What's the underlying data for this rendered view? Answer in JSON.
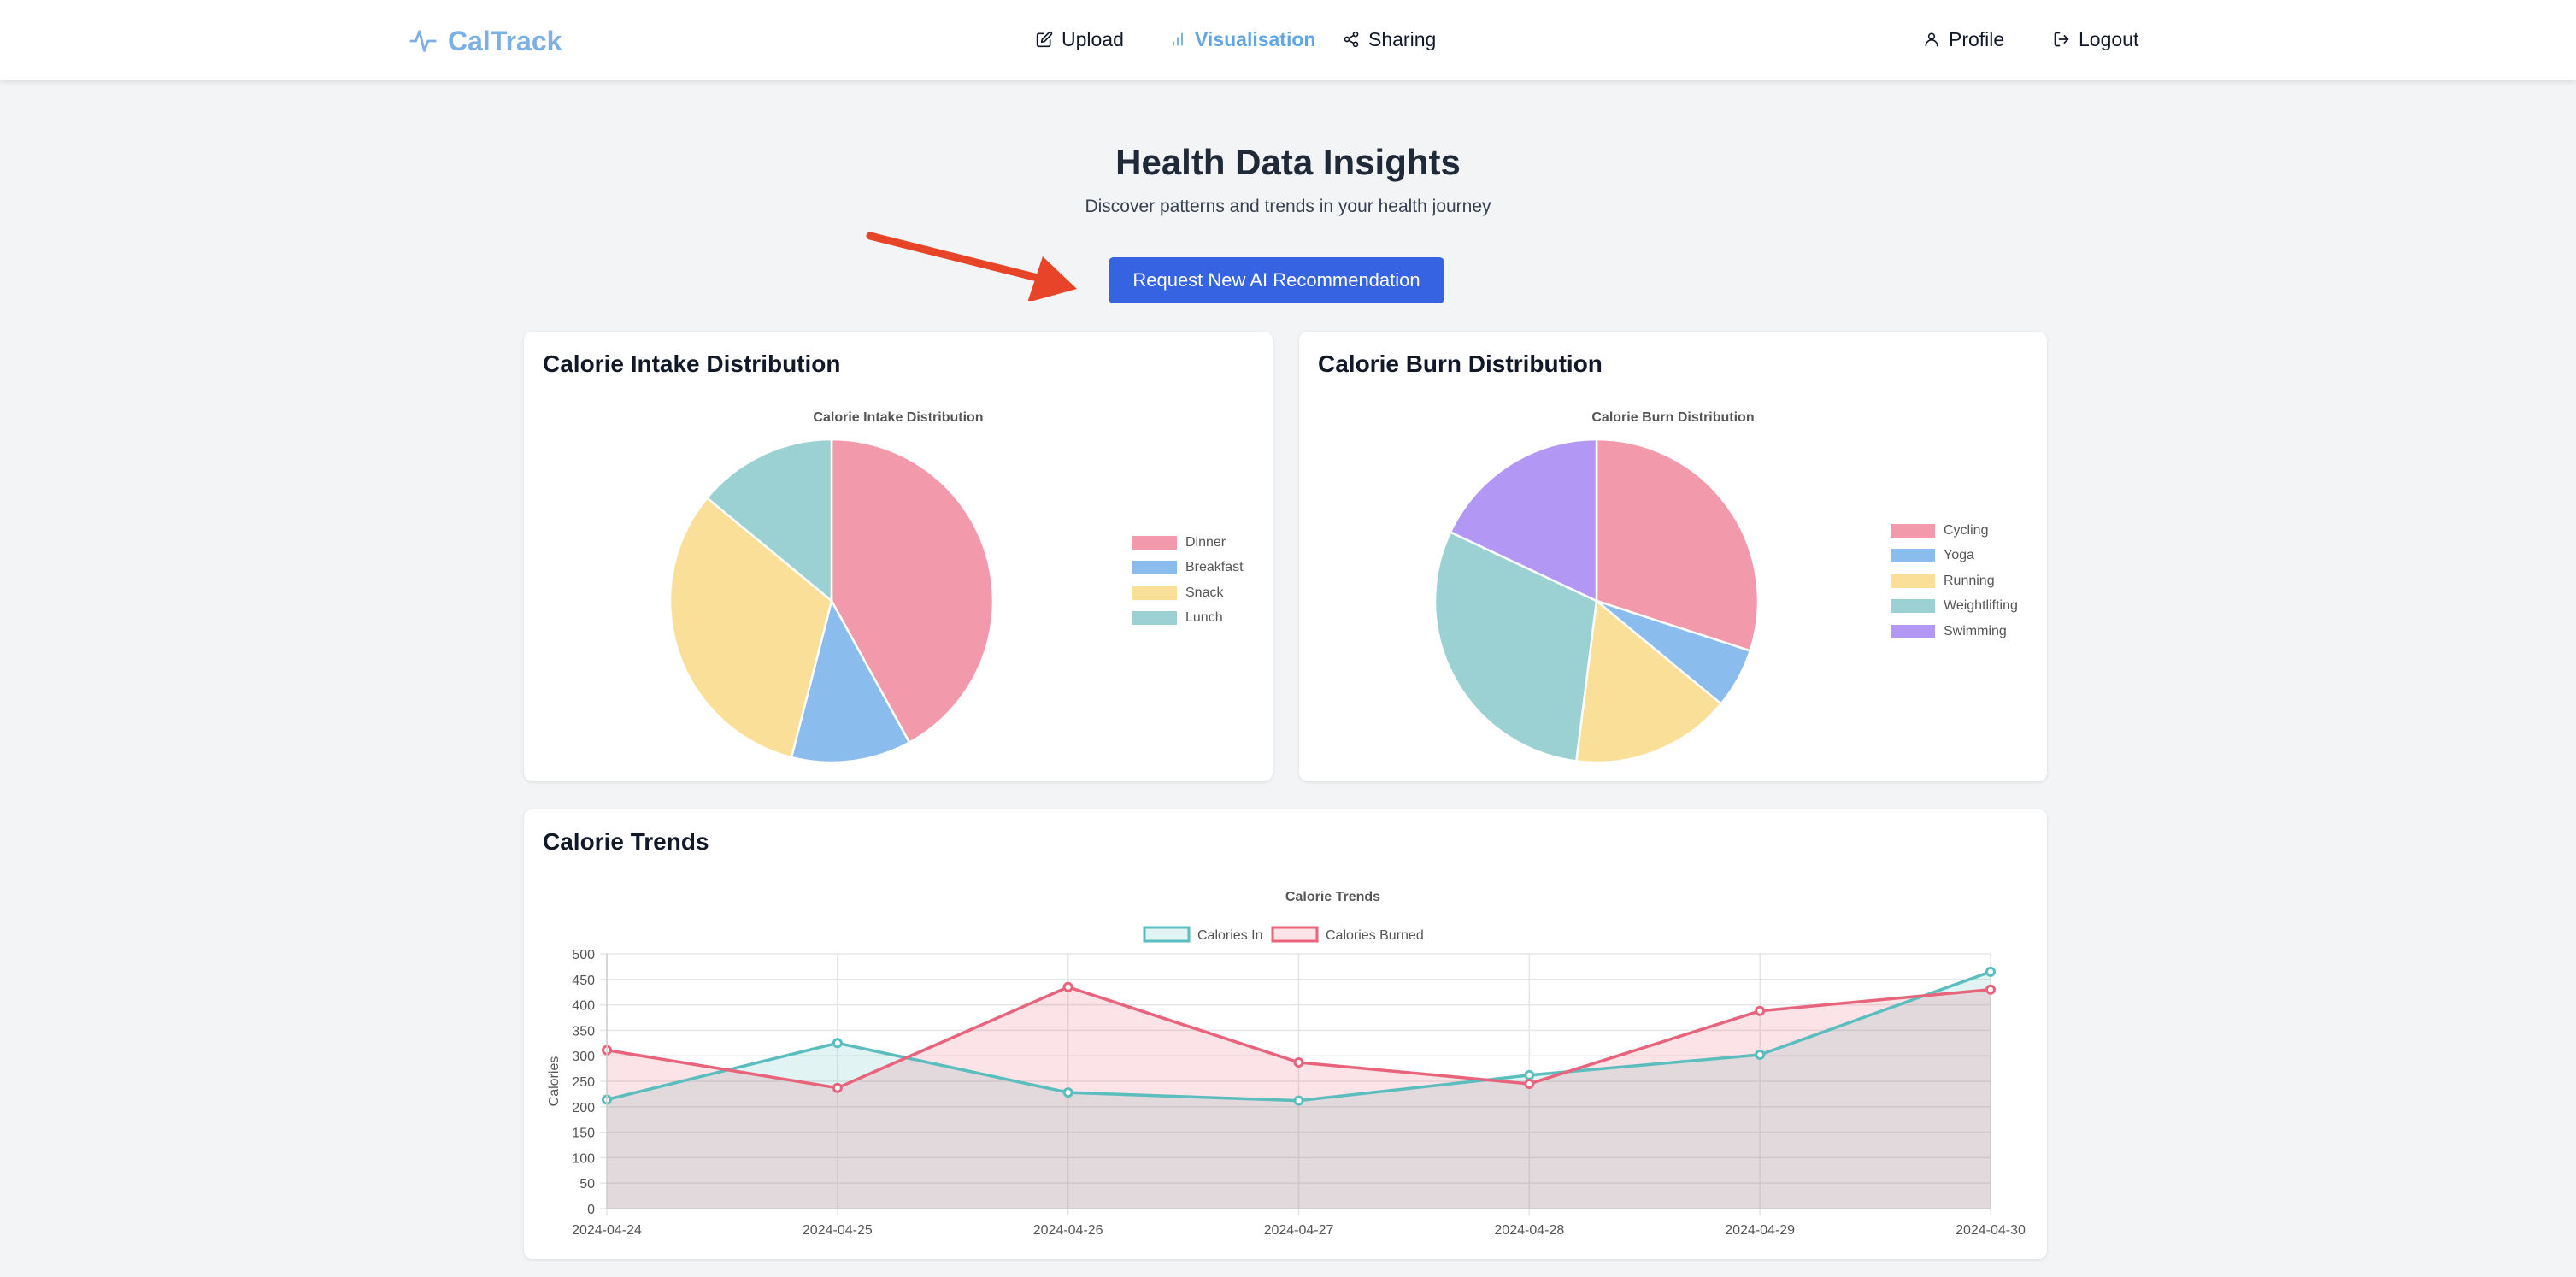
{
  "brand": {
    "name": "CalTrack",
    "color": "#7cb0e4"
  },
  "nav": {
    "upload": "Upload",
    "visualisation": "Visualisation",
    "sharing": "Sharing",
    "profile": "Profile",
    "logout": "Logout"
  },
  "hero": {
    "title": "Health Data Insights",
    "subtitle": "Discover patterns and trends in your health journey",
    "cta": "Request New AI Recommendation"
  },
  "cards": {
    "intake_title": "Calorie Intake Distribution",
    "burn_title": "Calorie Burn Distribution",
    "trends_title": "Calorie Trends"
  },
  "chart_data": [
    {
      "type": "pie",
      "title": "Calorie Intake Distribution",
      "labels": [
        "Dinner",
        "Breakfast",
        "Snack",
        "Lunch"
      ],
      "values": [
        42,
        12,
        32,
        14
      ],
      "colors": [
        "#f29aab",
        "#8abded",
        "#f9df98",
        "#9bd1d2"
      ],
      "legend": "right"
    },
    {
      "type": "pie",
      "title": "Calorie Burn Distribution",
      "labels": [
        "Cycling",
        "Yoga",
        "Running",
        "Weightlifting",
        "Swimming"
      ],
      "values": [
        30,
        6,
        16,
        30,
        18
      ],
      "colors": [
        "#f29aab",
        "#8abded",
        "#f9df98",
        "#9bd1d2",
        "#b397f5"
      ],
      "legend": "right"
    },
    {
      "type": "line",
      "title": "Calorie Trends",
      "x": [
        "2024-04-24",
        "2024-04-25",
        "2024-04-26",
        "2024-04-27",
        "2024-04-28",
        "2024-04-29",
        "2024-04-30"
      ],
      "series": [
        {
          "name": "Calories In",
          "values": [
            214,
            325,
            228,
            212,
            262,
            302,
            465
          ],
          "color": "#5bbdbd"
        },
        {
          "name": "Calories Burned",
          "values": [
            311,
            237,
            435,
            287,
            245,
            388,
            430
          ],
          "color": "#e8647c"
        }
      ],
      "ylabel": "Calories",
      "ylim": [
        0,
        500
      ],
      "yticks": [
        0,
        50,
        100,
        150,
        200,
        250,
        300,
        350,
        400,
        450,
        500
      ],
      "legend": "top",
      "grid": true,
      "fill": true
    }
  ]
}
